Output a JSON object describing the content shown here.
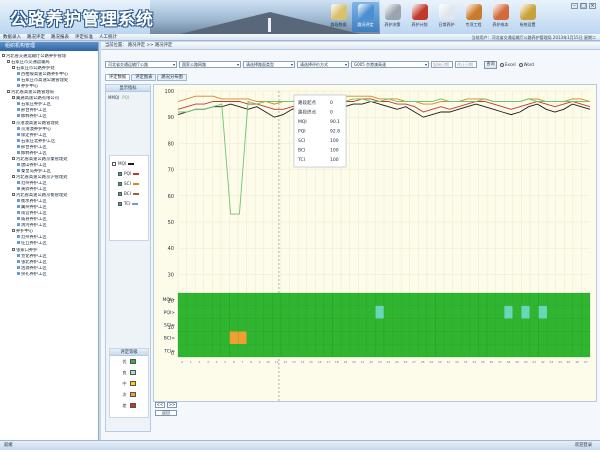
{
  "app": {
    "title": "公路养护管理系统"
  },
  "topnav": [
    {
      "label": "路段数据",
      "icon": "folder-icon",
      "color": "#d9c06a"
    },
    {
      "label": "路况评定",
      "icon": "chart-icon",
      "color": "#4b8fd1",
      "active": true
    },
    {
      "label": "养护决策",
      "icon": "tools-icon",
      "color": "#9aa4ae"
    },
    {
      "label": "养护计划",
      "icon": "car-icon",
      "color": "#c0392b"
    },
    {
      "label": "日常养护",
      "icon": "document-icon",
      "color": "#e0e6ee"
    },
    {
      "label": "专项工程",
      "icon": "worker-icon",
      "color": "#c97b2b"
    },
    {
      "label": "养护成本",
      "icon": "money-icon",
      "color": "#d46a3a"
    },
    {
      "label": "系统设置",
      "icon": "gear-icon",
      "color": "#c9a23a"
    }
  ],
  "menubar": {
    "items": [
      "数据录入",
      "路况评定",
      "路况报表",
      "评定标准",
      "人工统计"
    ],
    "status": "当前用户：河北省交通运输厅公路养护管理局  2013年1月15日  星期二"
  },
  "sidebar": {
    "title": "组织机构管理",
    "tree": [
      {
        "label": "河北省交通运输厅公路养护管理",
        "level": 0
      },
      {
        "label": "石家庄市交通运输局",
        "level": 1
      },
      {
        "label": "石家庄市公路养护处",
        "level": 2
      },
      {
        "label": "西柏坡高速公路养护中心",
        "level": 3
      },
      {
        "label": "石家庄市高速公路管理处",
        "level": 3
      },
      {
        "label": "养护中心",
        "level": 3
      },
      {
        "label": "河北省高速公路管理局",
        "level": 1
      },
      {
        "label": "冀通高速公路有限公司",
        "level": 2
      },
      {
        "label": "石家庄养护工区",
        "level": 3
      },
      {
        "label": "邢台养护工区",
        "level": 3
      },
      {
        "label": "邯郸养护工区",
        "level": 3
      },
      {
        "label": "京港澳高速公路管理处",
        "level": 2
      },
      {
        "label": "京港澳养护中心",
        "level": 3
      },
      {
        "label": "保定养护工区",
        "level": 3
      },
      {
        "label": "石家庄北养护工区",
        "level": 3
      },
      {
        "label": "邢台养护工区",
        "level": 3
      },
      {
        "label": "邯郸养护工区",
        "level": 3
      },
      {
        "label": "河北省高速公路京秦管理处",
        "level": 2
      },
      {
        "label": "唐山养护工区",
        "level": 3
      },
      {
        "label": "秦皇岛养护工区",
        "level": 3
      },
      {
        "label": "河北省高速公路京沪管理处",
        "level": 2
      },
      {
        "label": "沧州养护工区",
        "level": 3
      },
      {
        "label": "黄骅养护工区",
        "level": 3
      },
      {
        "label": "河北省高速公路京衡管理处",
        "level": 2
      },
      {
        "label": "衡水养护工区",
        "level": 3
      },
      {
        "label": "冀州养护工区",
        "level": 3
      },
      {
        "label": "南宫养护工区",
        "level": 3
      },
      {
        "label": "威县养护工区",
        "level": 3
      },
      {
        "label": "清河养护工区",
        "level": 3
      },
      {
        "label": "养护中心",
        "level": 2
      },
      {
        "label": "沧州养护工区",
        "level": 3
      },
      {
        "label": "任丘养护工区",
        "level": 3
      },
      {
        "label": "张家口养护",
        "level": 2
      },
      {
        "label": "宣化养护工区",
        "level": 3
      },
      {
        "label": "张北养护工区",
        "level": 3
      },
      {
        "label": "沽源养护工区",
        "level": 3
      },
      {
        "label": "崇礼养护工区",
        "level": 3
      }
    ]
  },
  "breadcrumb": "当前位置：  路况评定 >> 路况评定",
  "filters": [
    {
      "label": "河北省交通运输厅公路",
      "width": 72
    },
    {
      "label": "国家公路网路",
      "width": 62
    },
    {
      "label": "请选择路面类型",
      "width": 52
    },
    {
      "label": "请选择评价方式",
      "width": 52
    },
    {
      "label": "G005 京港澳高速",
      "width": 78
    }
  ],
  "date_placeholders": [
    "起始日期",
    "终止日期"
  ],
  "query_button": "查询",
  "radios": [
    "Excel",
    "Word"
  ],
  "tabs": [
    "评定数据",
    "评定图表",
    "路况分布图"
  ],
  "left_panel": {
    "title": "显示指标",
    "mmq": "MMQI",
    "pqi": "PQI",
    "series": [
      {
        "label": "MQI",
        "color": "#1a1a1a"
      },
      {
        "label": "PQI",
        "color": "#c0392b"
      },
      {
        "label": "SCI",
        "color": "#d08a20"
      },
      {
        "label": "BCI",
        "color": "#8a6d3b"
      },
      {
        "label": "TCI",
        "color": "#6f9bd6"
      }
    ],
    "legend_title": "评定等级",
    "grades": [
      {
        "label": "优",
        "color": "#2fb52f"
      },
      {
        "label": "良",
        "color": "#9be3d0"
      },
      {
        "label": "中",
        "color": "#f6d400"
      },
      {
        "label": "次",
        "color": "#f0a030"
      },
      {
        "label": "差",
        "color": "#d0301a"
      }
    ]
  },
  "tooltip": [
    {
      "k": "路段起点",
      "v": "0"
    },
    {
      "k": "路段终点",
      "v": "0"
    },
    {
      "k": "MQI",
      "v": "90.1"
    },
    {
      "k": "PQI",
      "v": "92.8"
    },
    {
      "k": "SCI",
      "v": "100"
    },
    {
      "k": "BCI",
      "v": "100"
    },
    {
      "k": "TCI",
      "v": "100"
    }
  ],
  "buttons": {
    "prev": "<<",
    "next": ">>",
    "back": "返回"
  },
  "statusbar": {
    "left": "就绪",
    "right": "欢迎登录"
  },
  "chart_data": {
    "type": "line",
    "ylim": [
      0,
      100
    ],
    "yticks": [
      0,
      10,
      20,
      30,
      40,
      50,
      60,
      70,
      80,
      90,
      100
    ],
    "series": [
      {
        "name": "MQI",
        "color": "#1a1a1a",
        "values": [
          91,
          92,
          93,
          93,
          94,
          94,
          95,
          94,
          93,
          94,
          92,
          90,
          91,
          93,
          94,
          95,
          94,
          93,
          94,
          94,
          95,
          95,
          96,
          95,
          94,
          93,
          94,
          92,
          90,
          91,
          92,
          92,
          93,
          94,
          95,
          94,
          93,
          92,
          91,
          92,
          94,
          95,
          93,
          92,
          93,
          95,
          94,
          93
        ]
      },
      {
        "name": "PQI",
        "color": "#c0392b",
        "values": [
          93,
          94,
          95,
          95,
          96,
          96,
          96,
          96,
          95,
          95,
          94,
          93,
          93,
          94,
          95,
          96,
          95,
          95,
          95,
          96,
          96,
          97,
          97,
          96,
          96,
          95,
          95,
          94,
          92,
          93,
          94,
          93,
          94,
          95,
          96,
          96,
          95,
          94,
          93,
          94,
          95,
          96,
          95,
          94,
          95,
          96,
          95,
          94
        ]
      },
      {
        "name": "SCI",
        "color": "#d08a20",
        "values": [
          96,
          97,
          98,
          98,
          98,
          97,
          97,
          97,
          97,
          96,
          96,
          95,
          96,
          96,
          97,
          98,
          97,
          97,
          97,
          98,
          98,
          98,
          98,
          97,
          97,
          97,
          96,
          96,
          95,
          95,
          96,
          96,
          96,
          97,
          97,
          97,
          96,
          96,
          96,
          96,
          97,
          97,
          96,
          96,
          96,
          97,
          97,
          96
        ]
      },
      {
        "name": "BCI",
        "color": "#6fc46f",
        "values": [
          92,
          92,
          93,
          93,
          94,
          95,
          53,
          53,
          96,
          95,
          96,
          96,
          96,
          96,
          96,
          96,
          96,
          97,
          97,
          96,
          97,
          97,
          96,
          96,
          97,
          96,
          96,
          96,
          96,
          96,
          97,
          96,
          96,
          96,
          96,
          97,
          96,
          96,
          96,
          96,
          97,
          96,
          96,
          96,
          96,
          96,
          96,
          96
        ]
      }
    ],
    "grid_rows": [
      "MQI",
      "PQI",
      "SCI",
      "BCI",
      "TCI"
    ],
    "grid_cols": 48,
    "grid_default": "#2fb52f",
    "grid_special": [
      {
        "row": 1,
        "col": 23,
        "color": "#66d8b6"
      },
      {
        "row": 1,
        "col": 38,
        "color": "#66d8b6"
      },
      {
        "row": 1,
        "col": 40,
        "color": "#66d8b6"
      },
      {
        "row": 1,
        "col": 42,
        "color": "#66d8b6"
      },
      {
        "row": 3,
        "col": 6,
        "color": "#f0a030"
      },
      {
        "row": 3,
        "col": 7,
        "color": "#f0a030"
      }
    ]
  }
}
